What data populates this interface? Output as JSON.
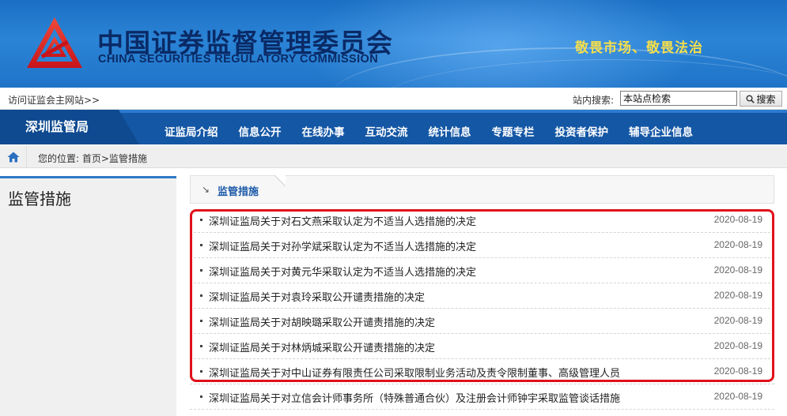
{
  "header": {
    "brand_cn": "中国证券监督管理委员会",
    "brand_en": "CHINA SECURITIES REGULATORY COMMISSION",
    "slogan": "敬畏市场、敬畏法治",
    "logo_icon": "csrc-logo-icon",
    "colors": {
      "banner": "#2b84d6",
      "brand_text": "#0a2a66",
      "slogan": "#f7df4a"
    }
  },
  "utility": {
    "visit_link": "访问证监会主网站>>",
    "search_label": "站内搜索:",
    "search_value": "本站点检索",
    "search_button": "搜索",
    "search_icon": "magnifier-icon"
  },
  "nav": {
    "home": "深圳监管局",
    "items": [
      "证监局介绍",
      "信息公开",
      "在线办事",
      "互动交流",
      "统计信息",
      "专题专栏",
      "投资者保护",
      "辅导企业信息"
    ],
    "colors": {
      "bar": "#1457a5",
      "home": "#0f4a90"
    }
  },
  "breadcrumb": {
    "prefix": "您的位置:",
    "home": "首页",
    "separator": ">",
    "current": "监管措施",
    "home_icon": "home-icon"
  },
  "sidebar": {
    "title": "监管措施"
  },
  "panel": {
    "arrow": "↘",
    "title": "监管措施",
    "items": [
      {
        "title": "深圳证监局关于对石文燕采取认定为不适当人选措施的决定",
        "date": "2020-08-19"
      },
      {
        "title": "深圳证监局关于对孙学斌采取认定为不适当人选措施的决定",
        "date": "2020-08-19"
      },
      {
        "title": "深圳证监局关于对黄元华采取认定为不适当人选措施的决定",
        "date": "2020-08-19"
      },
      {
        "title": "深圳证监局关于对袁玲采取公开谴责措施的决定",
        "date": "2020-08-19"
      },
      {
        "title": "深圳证监局关于对胡映璐采取公开谴责措施的决定",
        "date": "2020-08-19"
      },
      {
        "title": "深圳证监局关于对林炳城采取公开谴责措施的决定",
        "date": "2020-08-19"
      },
      {
        "title": "深圳证监局关于对中山证券有限责任公司采取限制业务活动及责令限制董事、高级管理人员",
        "date": "2020-08-19"
      },
      {
        "title": "深圳证监局关于对立信会计师事务所（特殊普通合伙）及注册会计师钟宇采取监管谈话措施",
        "date": "2020-08-19"
      }
    ],
    "highlight_color": "#e0101a"
  }
}
